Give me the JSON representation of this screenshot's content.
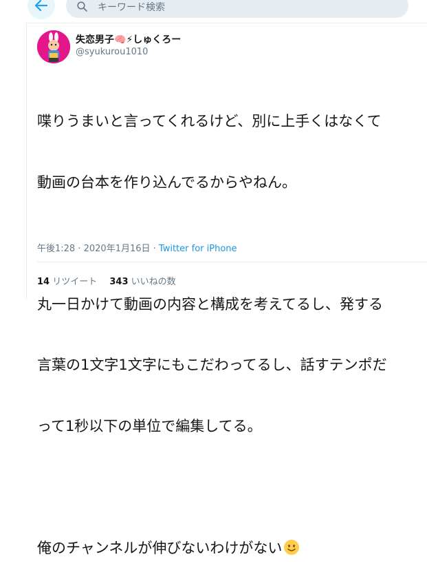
{
  "search": {
    "placeholder": "キーワード検索"
  },
  "profile": {
    "display_name": "失恋男子",
    "name_emoji_1": "🧠",
    "name_emoji_2": "⚡",
    "name_suffix": "しゅくろー",
    "handle": "@syukurou1010"
  },
  "tweet": {
    "lines": [
      "喋りうまいと言ってくれるけど、別に上手くはなくて",
      "動画の台本を作り込んでるからやねん。",
      "",
      "丸一日かけて動画の内容と構成を考えてるし、発する",
      "言葉の1文字1文字にもこだわってるし、話すテンポだ",
      "って1秒以下の単位で編集してる。",
      "",
      "俺のチャンネルが伸びないわけがない"
    ],
    "time": "午後1:28",
    "sep1": " · ",
    "date": "2020年1月16日",
    "sep2": " · ",
    "client": "Twitter for iPhone"
  },
  "stats": {
    "retweets_count": "14",
    "retweets_label": "リツイート",
    "likes_count": "343",
    "likes_label": "いいねの数"
  },
  "colors": {
    "accent": "#1b95e0",
    "secondary_text": "#657786",
    "avatar_bg": "#e4168a"
  },
  "icons": {
    "back": "arrow-left-icon",
    "search": "search-icon",
    "smiley": "smiling-face-emoji"
  }
}
